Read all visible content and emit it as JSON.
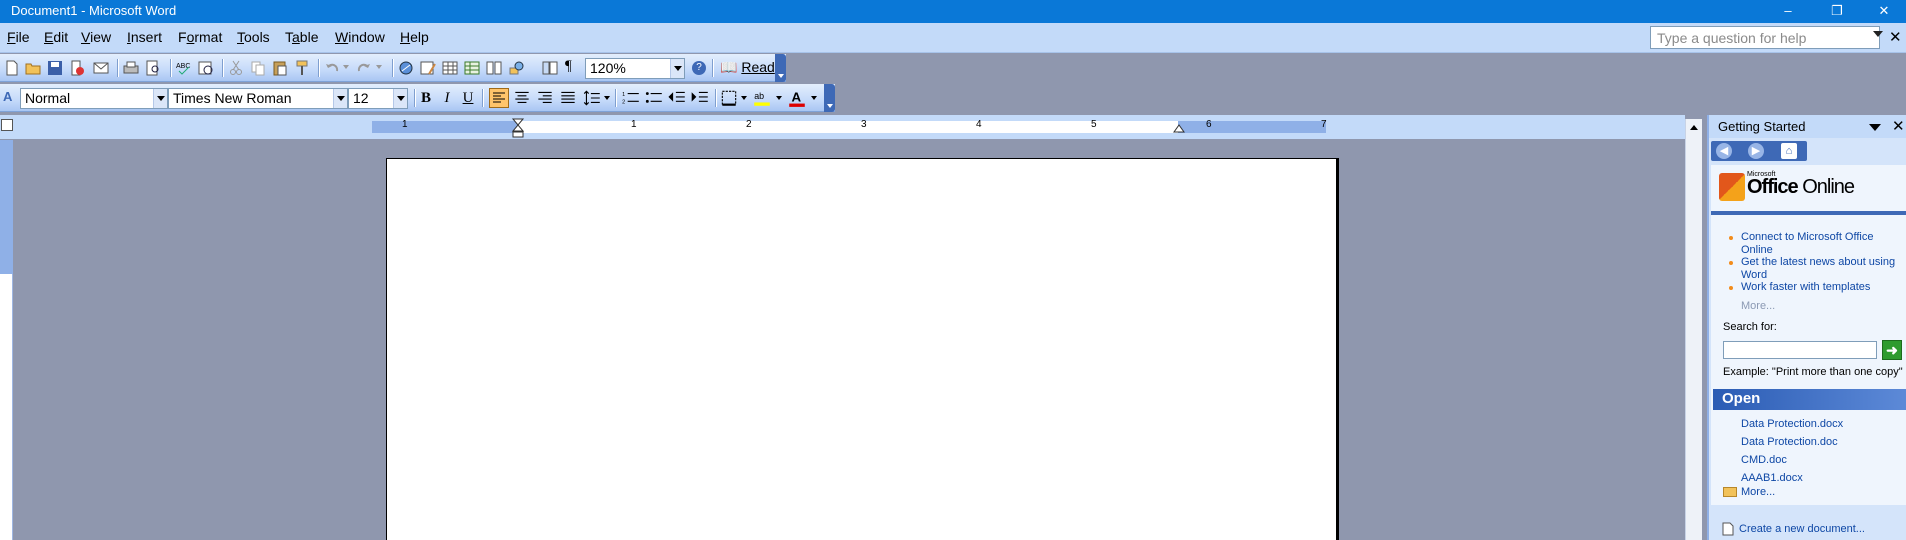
{
  "window": {
    "title": "Document1 - Microsoft Word",
    "controls": {
      "minimize": "–",
      "restore": "❐",
      "close": "✕"
    }
  },
  "menu": {
    "items": [
      {
        "label": "File",
        "key": "F"
      },
      {
        "label": "Edit",
        "key": "E"
      },
      {
        "label": "View",
        "key": "V"
      },
      {
        "label": "Insert",
        "key": "I"
      },
      {
        "label": "Format",
        "key": "o"
      },
      {
        "label": "Tools",
        "key": "T"
      },
      {
        "label": "Table",
        "key": "a"
      },
      {
        "label": "Window",
        "key": "W"
      },
      {
        "label": "Help",
        "key": "H"
      }
    ],
    "help_placeholder": "Type a question for help"
  },
  "standard_toolbar": {
    "zoom": "120%",
    "read_label": "Read"
  },
  "formatting_toolbar": {
    "style": "Normal",
    "font": "Times New Roman",
    "size": "12",
    "bold": "B",
    "italic": "I",
    "underline": "U"
  },
  "ruler": {
    "numbers": [
      "1",
      "1",
      "2",
      "3",
      "4",
      "5",
      "6",
      "7"
    ]
  },
  "task_pane": {
    "title": "Getting Started",
    "logo_small": "Microsoft",
    "logo_office": "Office",
    "logo_online": " Online",
    "links": [
      "Connect to Microsoft Office Online",
      "Get the latest news about using Word",
      "Work faster with templates"
    ],
    "more_1": "More...",
    "search_label": "Search for:",
    "example": "Example:  \"Print more than one copy\"",
    "open_heading": "Open",
    "recent_files": [
      "Data Protection.docx",
      "Data Protection.doc",
      "CMD.doc",
      "AAAB1.docx"
    ],
    "more_2": "More...",
    "create_new": "Create a new document..."
  },
  "colors": {
    "titlebar": "#0a78d7",
    "menubar": "#c3daf9",
    "link": "#0e47a5",
    "accent": "#3e69b6"
  }
}
